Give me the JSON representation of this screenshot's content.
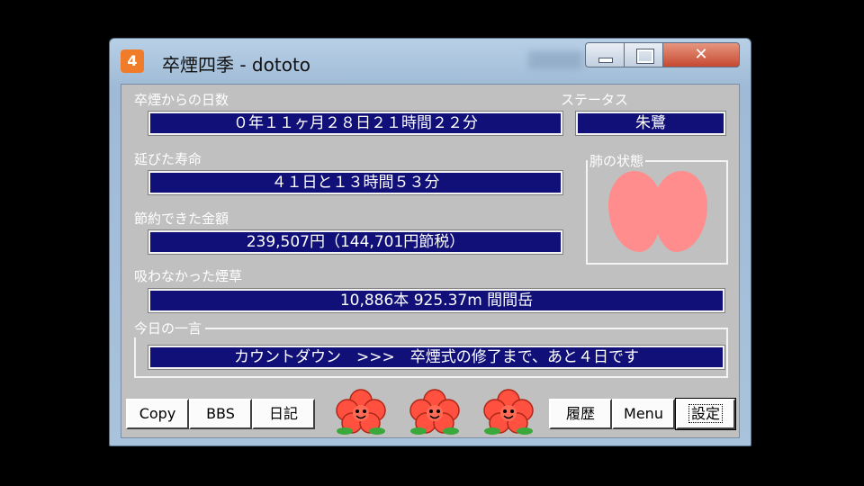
{
  "window": {
    "icon_glyph": "4",
    "title": "卒煙四季 - dototo",
    "close_glyph": "✕"
  },
  "days": {
    "label": "卒煙からの日数",
    "value": "０年１１ヶ月２８日２１時間２２分"
  },
  "status": {
    "label": "ステータス",
    "value": "朱鷺"
  },
  "life": {
    "label": "延びた寿命",
    "value": "４１日と１３時間５３分"
  },
  "lungs": {
    "label": "肺の状態",
    "color": "#ff8d8d"
  },
  "money": {
    "label": "節約できた金額",
    "value": "239,507円（144,701円節税）"
  },
  "cigs": {
    "label": "吸わなかった煙草",
    "value": "10,886本 925.37m 間間岳"
  },
  "today": {
    "label": "今日の一言",
    "value": "カウントダウン　>>>　卒煙式の修了まで、あと４日です"
  },
  "buttons": {
    "copy": "Copy",
    "bbs": "BBS",
    "diary": "日記",
    "history": "履歴",
    "menu": "Menu",
    "settings": "設定"
  },
  "colors": {
    "bar_bg": "#101078",
    "flower": "#ff5040",
    "leaf": "#3aa83a"
  }
}
